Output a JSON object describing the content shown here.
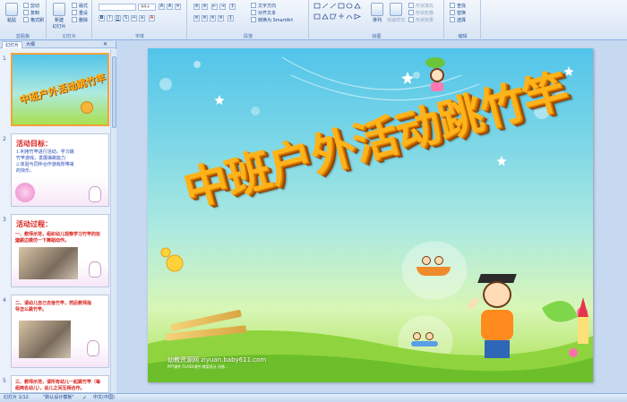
{
  "ribbon": {
    "clipboard": {
      "label": "剪贴板",
      "paste": "粘贴",
      "cut": "剪切",
      "copy": "复制",
      "format_painter": "格式刷"
    },
    "slides": {
      "label": "幻灯片",
      "new_slide": "新建\n幻灯片",
      "layout": "版式",
      "reset": "重设",
      "delete": "删除"
    },
    "font": {
      "label": "字体",
      "font_size": "44+"
    },
    "paragraph": {
      "label": "段落",
      "text_direction": "文字方向",
      "align_text": "对齐文本",
      "smartart": "转换为 SmartArt"
    },
    "drawing": {
      "label": "绘图",
      "arrange": "排列",
      "quick_styles": "快速样式",
      "shape_fill": "形状填充",
      "shape_outline": "形状轮廓",
      "shape_effects": "形状效果"
    },
    "editing": {
      "label": "编辑",
      "find": "查找",
      "replace": "替换",
      "select": "选择"
    }
  },
  "left_panel": {
    "tabs": [
      "幻灯片",
      "大纲"
    ],
    "thumbnails": [
      {
        "num": "1",
        "title": "中班户外活动跳竹竿"
      },
      {
        "num": "2",
        "title": "活动目标：",
        "lines": [
          "1.利用竹竿进行活动，学习跳",
          "竹竿游戏，发展弹跳能力",
          "2.体验与同伴合作游戏所带来",
          "的快乐。"
        ]
      },
      {
        "num": "3",
        "title": "活动过程：",
        "lines": [
          "一、教师示范，组织幼儿观察学习竹竿的玩法，",
          "边跳边模仿一下舞蹈动作。"
        ]
      },
      {
        "num": "4",
        "lines": [
          "二、请幼儿自己去拾竹竿，然后教师指",
          "导怎么跳竹竿。"
        ]
      },
      {
        "num": "5",
        "lines": [
          "三、教师示范，请所有幼儿一起跳竹竿（每",
          "组两名幼儿），幼儿之间互相合作。"
        ]
      }
    ]
  },
  "slide": {
    "title": "中班户外活动跳竹竿",
    "watermark": "幼教资源网 ziyuan.baby611.com",
    "watermark_sub": "PPT课件  FLASH课件  教案设计  试卷..."
  },
  "status": {
    "slide_info": "幻灯片 1/12",
    "theme": "\"默认设计模板\"",
    "language": "中文(中国)"
  },
  "colors": {
    "accent": "#ffb31a",
    "ribbon_bg": "#dfe9f5",
    "selection": "#f2a33c"
  }
}
